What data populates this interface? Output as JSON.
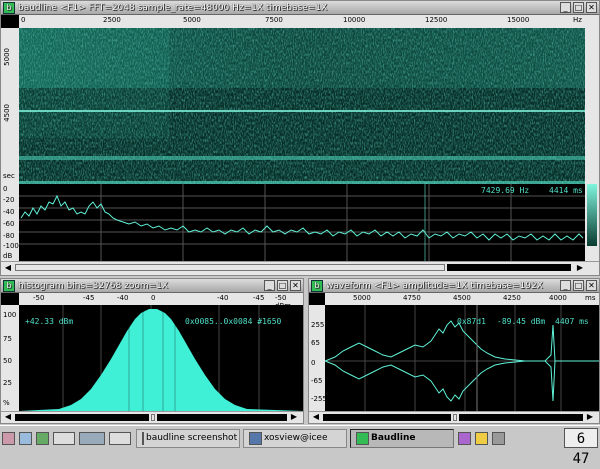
{
  "main_window": {
    "title": "baudline  <F1> FFT=2048 sample_rate=48000 Hz=1X timebase=1X",
    "freq_ruler": [
      "0",
      "2500",
      "5000",
      "7500",
      "10000",
      "12500",
      "15000",
      "Hz"
    ],
    "spectro_vruler": [
      "5000",
      "4500",
      "sec"
    ],
    "spectrum_vruler": [
      "0",
      "-20",
      "-40",
      "-60",
      "-80",
      "-100",
      "dB"
    ],
    "readout_hz": "7429.69 Hz",
    "readout_ms": "4414 ms"
  },
  "histogram_window": {
    "title": "histogram  bins=32768 zoom=1X",
    "ruler": [
      "-50",
      "-45",
      "-40",
      "0",
      "-40",
      "-45",
      "-50 dBm"
    ],
    "vruler": [
      "100",
      "75",
      "50",
      "25",
      "%"
    ],
    "readout_left": "+42.33 dBm",
    "readout_right": "0x0085..0x0084 #1650"
  },
  "waveform_window": {
    "title": "waveform  <F1> amplitude=1X timebase=192X",
    "ruler": [
      "5000",
      "4750",
      "4500",
      "4250",
      "4000",
      "ms"
    ],
    "vruler": [
      "255",
      "65",
      "0",
      "-65",
      "-255"
    ],
    "readout_left": "0x87d1",
    "readout_mid": "-89.45 dBm",
    "readout_right": "4407 ms"
  },
  "taskbar": {
    "items": [
      {
        "label": "baudline screenshot",
        "active": false
      },
      {
        "label": "xosview@icee",
        "active": false
      },
      {
        "label": "Baudline",
        "active": true
      }
    ],
    "clock": "6 47"
  }
}
